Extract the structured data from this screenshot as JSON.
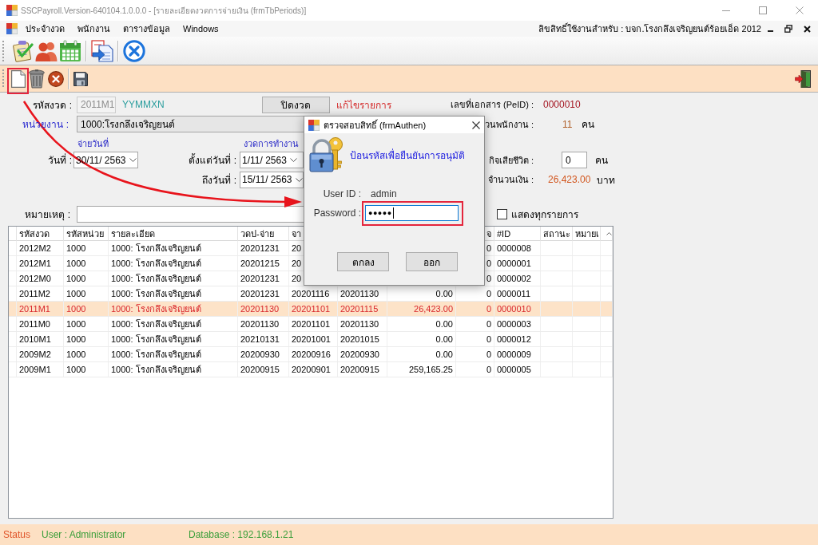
{
  "window": {
    "title": "SSCPayroll.Version-640104.1.0.0.0 - [รายละเอียดงวดการจ่ายเงิน (frmTbPeriods)]"
  },
  "menu_bar": {
    "items": [
      "ประจำงวด",
      "พนักงาน",
      "ตารางข้อมูล",
      "Windows"
    ],
    "license": "ลิขสิทธิ์ใช้งานสำหรับ : บจก.โรงกลึงเจริญยนต์ร้อยเอ็ด 2012"
  },
  "form": {
    "period_code": {
      "label": "รหัสงวด :",
      "value": "2011M1",
      "disabled": true
    },
    "format_hint": "YYMMXN",
    "close_period_button": "ปิดงวด",
    "mode": "แก้ไขรายการ",
    "document_no": {
      "label": "เลขที่เอกสาร (PeID) :",
      "value": "0000010"
    },
    "unit": {
      "label": "หน่วยงาน :",
      "value": "1000:โรงกลึงเจริญยนต์"
    },
    "employee_count": {
      "label": "วนพนักงาน :",
      "value": "11",
      "unit": "คน"
    },
    "pay_heading": "จ่ายวันที่",
    "work_period_heading": "งวดการทำงาน",
    "pay_date": {
      "label": "วันที่ :",
      "value": "30/11/ 2563"
    },
    "from_date": {
      "label": "ตั้งแต่วันที่ :",
      "value": "1/11/ 2563"
    },
    "to_date": {
      "label": "ถึงวันที่ :",
      "value": "15/11/ 2563"
    },
    "deceased_count": {
      "label": "กิจเสียชีวิต :",
      "value": "0",
      "unit": "คน"
    },
    "amount": {
      "label": "จำนวนเงิน :",
      "value": "26,423.00",
      "unit": "บาท"
    },
    "note": {
      "label": "หมายเหตุ :"
    },
    "show_all": {
      "label": "แสดงทุกรายการ",
      "checked": false
    }
  },
  "table": {
    "header": {
      "period_code": "รหัสงวด",
      "unit_code": "รหัสหน่วย",
      "detail": "รายละเอียด",
      "pay_date": "วดป-จ่าย",
      "from_date": "จา",
      "column_8": "จ",
      "id": "#ID",
      "status": "สถานะ",
      "column_11": "หมายเ"
    },
    "rows": [
      {
        "period_code": "2012M2",
        "unit_code": "1000",
        "detail": "1000: โรงกลึงเจริญยนต์",
        "pay_date": "20201231",
        "from_date": "20",
        "column_8": "0",
        "id": "0000008",
        "selected": false
      },
      {
        "period_code": "2012M1",
        "unit_code": "1000",
        "detail": "1000: โรงกลึงเจริญยนต์",
        "pay_date": "20201215",
        "from_date": "20",
        "column_8": "0",
        "id": "0000001",
        "selected": false
      },
      {
        "period_code": "2012M0",
        "unit_code": "1000",
        "detail": "1000: โรงกลึงเจริญยนต์",
        "pay_date": "20201231",
        "from_date": "20",
        "column_8": "0",
        "id": "0000002",
        "selected": false
      },
      {
        "period_code": "2011M2",
        "unit_code": "1000",
        "detail": "1000: โรงกลึงเจริญยนต์",
        "pay_date": "20201231",
        "from_date": "20201116",
        "column_6": "20201130",
        "column_7": "0.00",
        "column_8": "0",
        "id": "0000011",
        "selected": false
      },
      {
        "period_code": "2011M1",
        "unit_code": "1000",
        "detail": "1000: โรงกลึงเจริญยนต์",
        "pay_date": "20201130",
        "from_date": "20201101",
        "column_6": "20201115",
        "column_7": "26,423.00",
        "column_8": "0",
        "id": "0000010",
        "selected": true
      },
      {
        "period_code": "2011M0",
        "unit_code": "1000",
        "detail": "1000: โรงกลึงเจริญยนต์",
        "pay_date": "20201130",
        "from_date": "20201101",
        "column_6": "20201130",
        "column_7": "0.00",
        "column_8": "0",
        "id": "0000003",
        "selected": false
      },
      {
        "period_code": "2010M1",
        "unit_code": "1000",
        "detail": "1000: โรงกลึงเจริญยนต์",
        "pay_date": "20210131",
        "from_date": "20201001",
        "column_6": "20201015",
        "column_7": "0.00",
        "column_8": "0",
        "id": "0000012",
        "selected": false
      },
      {
        "period_code": "2009M2",
        "unit_code": "1000",
        "detail": "1000: โรงกลึงเจริญยนต์",
        "pay_date": "20200930",
        "from_date": "20200916",
        "column_6": "20200930",
        "column_7": "0.00",
        "column_8": "0",
        "id": "0000009",
        "selected": false
      },
      {
        "period_code": "2009M1",
        "unit_code": "1000",
        "detail": "1000: โรงกลึงเจริญยนต์",
        "pay_date": "20200915",
        "from_date": "20200901",
        "column_6": "20200915",
        "column_7": "259,165.25",
        "column_8": "0",
        "id": "0000005",
        "selected": false
      }
    ]
  },
  "dialog": {
    "title": "ตรวจสอบสิทธิ์ (frmAuthen)",
    "message": "ป้อนรหัสเพื่อยืนยันการอนุมัติ",
    "user_id": {
      "label": "User ID :",
      "value": "admin"
    },
    "password": {
      "label": "Password :",
      "value": "●●●●●"
    },
    "buttons": [
      "ตกลง",
      "ออก"
    ]
  },
  "status_bar": {
    "status": "Status",
    "user": "User : Administrator",
    "database": "Database : 192.168.1.21"
  }
}
